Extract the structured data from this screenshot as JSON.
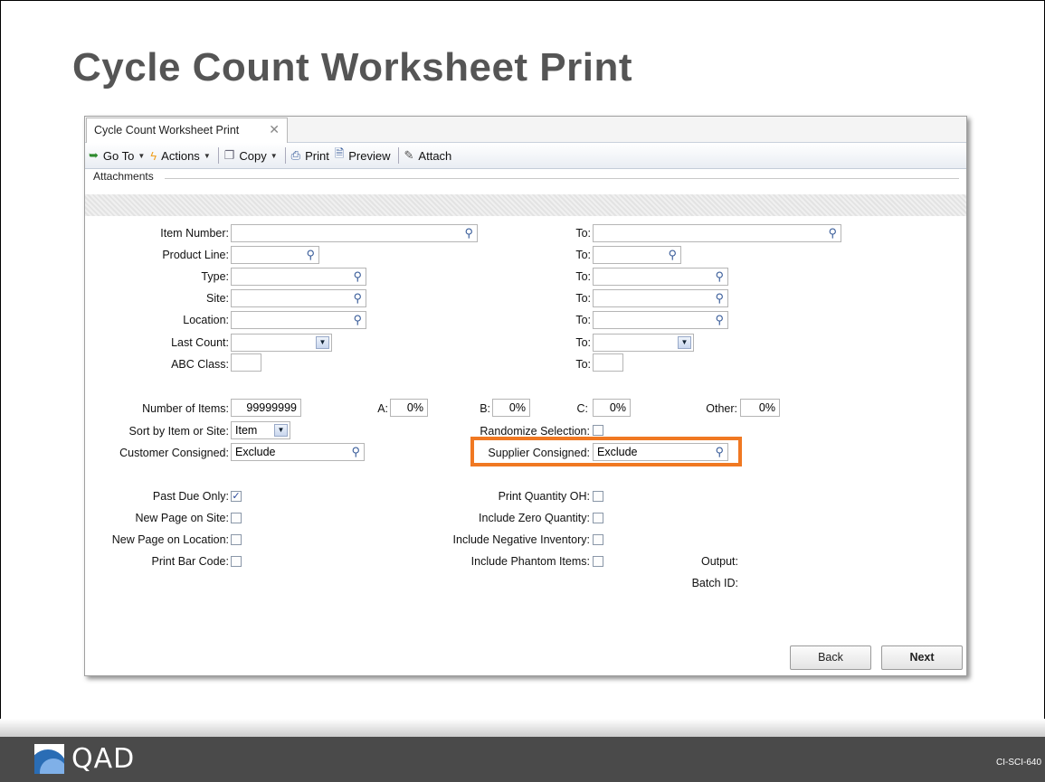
{
  "slide": {
    "title": "Cycle Count Worksheet Print",
    "code": "CI-SCI-640",
    "logo_text": "QAD"
  },
  "window": {
    "tab_label": "Cycle Count Worksheet Print",
    "toolbar": {
      "goto": "Go To",
      "actions": "Actions",
      "copy": "Copy",
      "print": "Print",
      "preview": "Preview",
      "attach": "Attach"
    },
    "attachments_label": "Attachments"
  },
  "form": {
    "item_number_label": "Item Number:",
    "product_line_label": "Product Line:",
    "type_label": "Type:",
    "site_label": "Site:",
    "location_label": "Location:",
    "last_count_label": "Last Count:",
    "abc_class_label": "ABC Class:",
    "to_label": "To:",
    "number_of_items_label": "Number of Items:",
    "number_of_items": "99999999",
    "a_label": "A:",
    "a_value": "0%",
    "b_label": "B:",
    "b_value": "0%",
    "c_label": "C:",
    "c_value": "0%",
    "other_label": "Other:",
    "other_value": "0%",
    "sort_label": "Sort by Item or Site:",
    "sort_value": "Item",
    "randomize_label": "Randomize Selection:",
    "customer_consigned_label": "Customer Consigned:",
    "customer_consigned_value": "Exclude",
    "supplier_consigned_label": "Supplier Consigned:",
    "supplier_consigned_value": "Exclude",
    "past_due_label": "Past Due Only:",
    "past_due_checked": true,
    "new_page_site_label": "New Page on Site:",
    "new_page_location_label": "New Page on Location:",
    "print_bar_code_label": "Print Bar Code:",
    "print_qty_oh_label": "Print Quantity OH:",
    "include_zero_label": "Include Zero Quantity:",
    "include_negative_label": "Include Negative Inventory:",
    "include_phantom_label": "Include Phantom Items:",
    "output_label": "Output:",
    "batch_id_label": "Batch ID:"
  },
  "buttons": {
    "back": "Back",
    "next": "Next"
  },
  "colors": {
    "highlight": "#f07822",
    "footer": "#4a4a4a",
    "title": "#555555"
  },
  "icons": [
    "goto-arrow-icon",
    "actions-lightning-icon",
    "copy-icon",
    "print-icon",
    "preview-icon",
    "attach-paperclip-icon",
    "lookup-magnifier-icon",
    "close-icon",
    "chevron-down-icon",
    "qad-logo-icon"
  ]
}
